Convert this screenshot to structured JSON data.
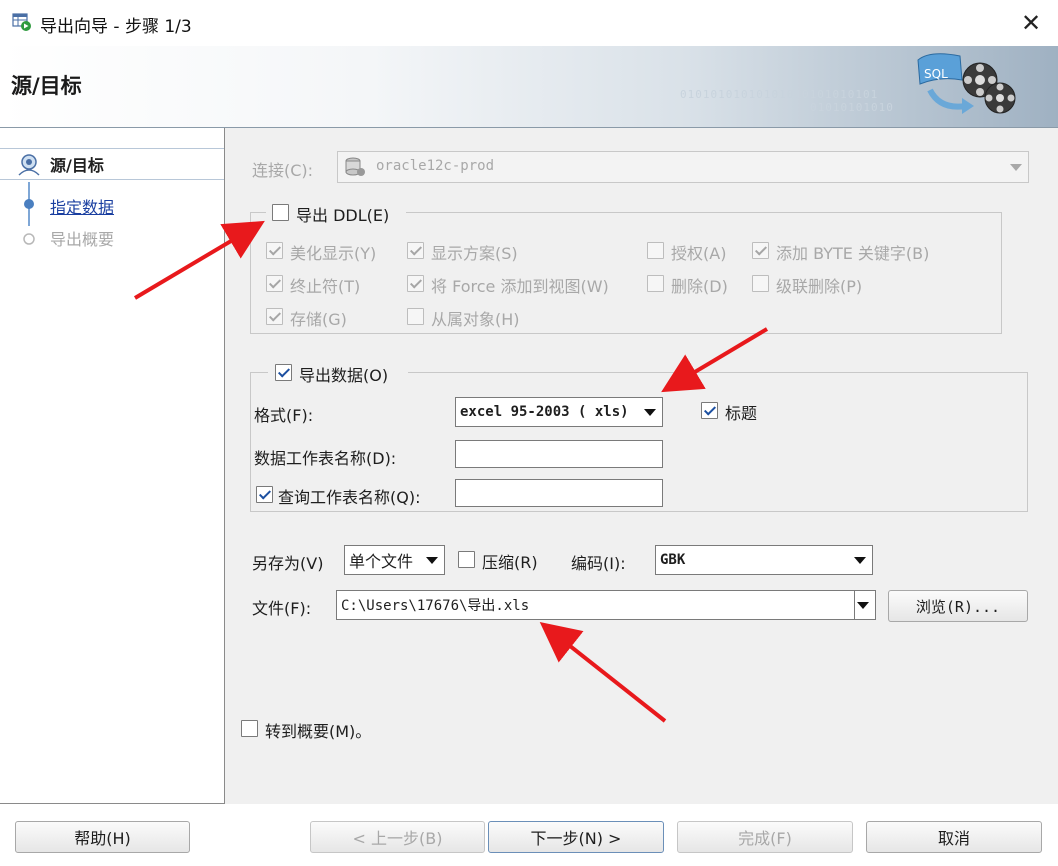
{
  "window": {
    "title": "导出向导 - 步骤 1/3",
    "close_symbol": "✕"
  },
  "banner": {
    "title": "源/目标",
    "binary_line1": "01010101010101010101010101",
    "binary_line2": "01010101010",
    "graphic_label": "SQL"
  },
  "steps": [
    {
      "label": "源/目标",
      "state": "current"
    },
    {
      "label": "指定数据",
      "state": "link"
    },
    {
      "label": "导出概要",
      "state": "disabled"
    }
  ],
  "connection": {
    "label": "连接(C):",
    "value": "oracle12c-prod"
  },
  "ddl": {
    "label": "导出 DDL(E)",
    "checked": false,
    "options": [
      {
        "label": "美化显示(Y)",
        "checked": true
      },
      {
        "label": "显示方案(S)",
        "checked": true
      },
      {
        "label": "授权(A)",
        "checked": false
      },
      {
        "label": "添加 BYTE 关键字(B)",
        "checked": true
      },
      {
        "label": "终止符(T)",
        "checked": true
      },
      {
        "label": "将 Force 添加到视图(W)",
        "checked": true
      },
      {
        "label": "删除(D)",
        "checked": false
      },
      {
        "label": "级联删除(P)",
        "checked": false
      },
      {
        "label": "存储(G)",
        "checked": true
      },
      {
        "label": "从属对象(H)",
        "checked": false
      }
    ]
  },
  "data_export": {
    "label": "导出数据(O)",
    "checked": true,
    "format_label": "格式(F):",
    "format_value": "excel 95-2003 ( xls)",
    "header_label": "标题",
    "header_checked": true,
    "sheet_name_label": "数据工作表名称(D):",
    "sheet_name_value": "",
    "query_sheet_label": "查询工作表名称(Q):",
    "query_sheet_checked": true,
    "query_sheet_value": ""
  },
  "save": {
    "save_as_label": "另存为(V)",
    "save_as_value": "单个文件",
    "compress_label": "压缩(R)",
    "compress_checked": false,
    "encoding_label": "编码(I):",
    "encoding_value": "GBK",
    "file_label": "文件(F):",
    "file_value": "C:\\Users\\17676\\导出.xls",
    "browse_label": "浏览(R)..."
  },
  "summary_checkbox": {
    "label": "转到概要(M)。",
    "checked": false
  },
  "footer": {
    "help": "帮助(H)",
    "back": "< 上一步(B)",
    "next": "下一步(N) >",
    "finish": "完成(F)",
    "cancel": "取消"
  },
  "colors": {
    "annotation_arrow": "#e8191c",
    "link": "#1a3fa0",
    "check": "#1b4fa0"
  }
}
